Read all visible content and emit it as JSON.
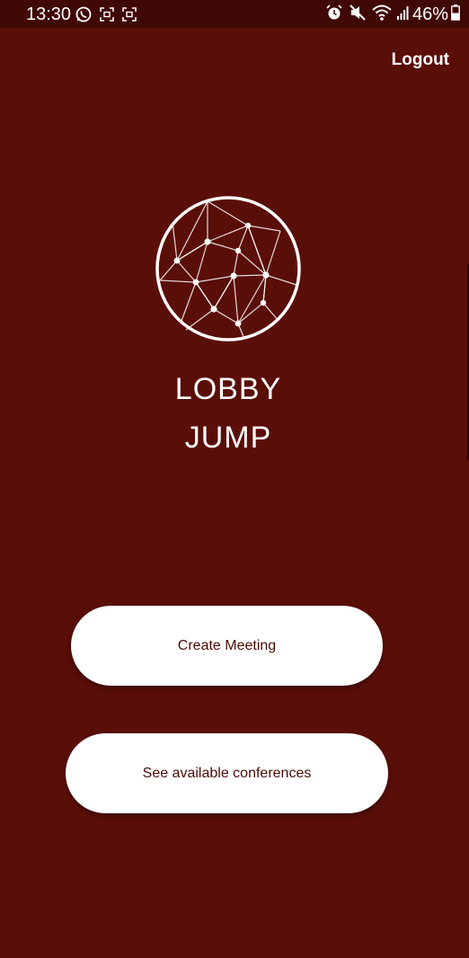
{
  "status_bar": {
    "time": "13:30",
    "battery": "46%",
    "left_icons": [
      "whatsapp-icon",
      "screenshot-icon",
      "screenshot-icon"
    ],
    "right_icons": [
      "alarm-icon",
      "mute-icon",
      "wifi-icon",
      "signal-icon",
      "battery-icon"
    ]
  },
  "header": {
    "logout_label": "Logout"
  },
  "app": {
    "name_line1": "LOBBY",
    "name_line2": "JUMP",
    "logo_icon": "network-globe-icon"
  },
  "actions": {
    "create_label": "Create Meeting",
    "conferences_label": "See available conferences"
  },
  "colors": {
    "background": "#5a0e08",
    "status_bar": "#3f0805",
    "button_bg": "#ffffff",
    "button_text": "#4a0b06"
  }
}
